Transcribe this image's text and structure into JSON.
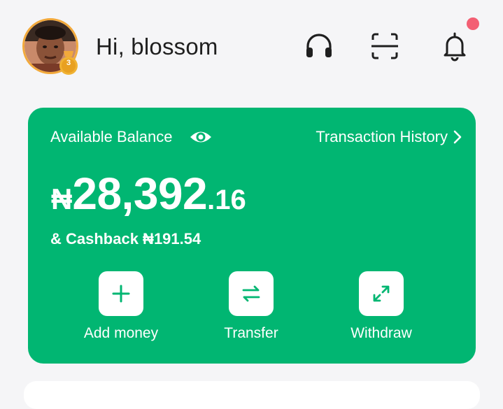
{
  "header": {
    "greeting": "Hi, blossom",
    "level_badge": "3",
    "icons": [
      "headset-icon",
      "scan-icon",
      "bell-icon"
    ],
    "has_notification": true
  },
  "balance_card": {
    "available_label": "Available Balance",
    "history_label": "Transaction History",
    "currency_symbol": "₦",
    "balance_whole": "28,392",
    "balance_decimal": ".16",
    "cashback_text": "& Cashback ₦191.54",
    "actions": [
      {
        "label": "Add money",
        "icon": "plus-icon"
      },
      {
        "label": "Transfer",
        "icon": "transfer-arrows-icon"
      },
      {
        "label": "Withdraw",
        "icon": "expand-arrows-icon"
      }
    ]
  },
  "colors": {
    "accent": "#01b672",
    "background": "#f5f5f7",
    "notification": "#f35f73",
    "avatar_ring": "#f2a93b"
  }
}
